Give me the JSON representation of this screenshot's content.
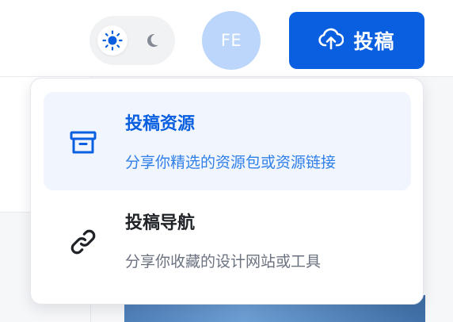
{
  "header": {
    "theme_toggle": {
      "light_icon": "sun-icon",
      "dark_icon": "moon-icon",
      "selected": "light"
    },
    "avatar_initials": "FE",
    "submit_button": {
      "icon": "cloud-upload-icon",
      "label": "投稿"
    }
  },
  "submit_menu": {
    "items": [
      {
        "icon": "archive-box-icon",
        "title": "投稿资源",
        "description": "分享你精选的资源包或资源链接",
        "active": true
      },
      {
        "icon": "link-icon",
        "title": "投稿导航",
        "description": "分享你收藏的设计网站或工具",
        "active": false
      }
    ]
  },
  "colors": {
    "accent": "#0a5fe0",
    "accent_light": "#2f7fe8",
    "active_item_bg": "#f1f6fe",
    "avatar_bg": "#bcd6fb"
  }
}
